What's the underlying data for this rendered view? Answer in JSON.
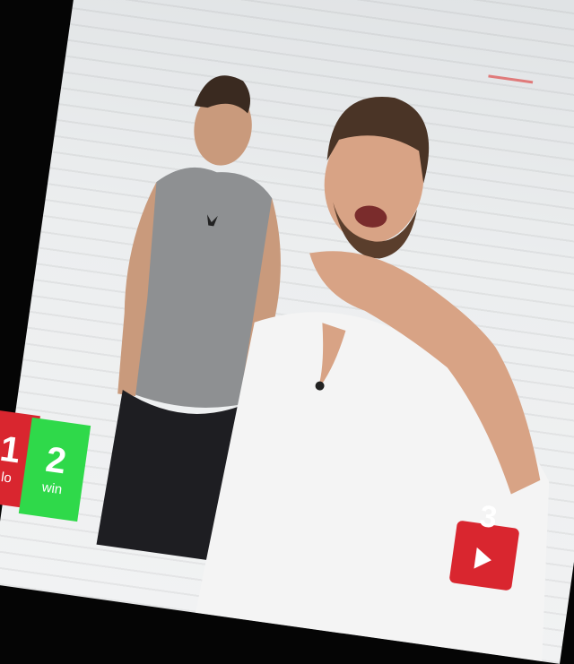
{
  "scoreboard": {
    "left_badge": {
      "number": "1",
      "label": "lo"
    },
    "win_badge": {
      "number": "2",
      "label": "win"
    },
    "right_badge": {
      "number": "3"
    }
  },
  "colors": {
    "loss_red": "#d9262f",
    "win_green": "#2fd94a",
    "wall": "#eceeef",
    "tank_top": "#8e9092",
    "shirt_white": "#f4f4f4"
  },
  "icons": {
    "play": "play-triangle-icon"
  }
}
